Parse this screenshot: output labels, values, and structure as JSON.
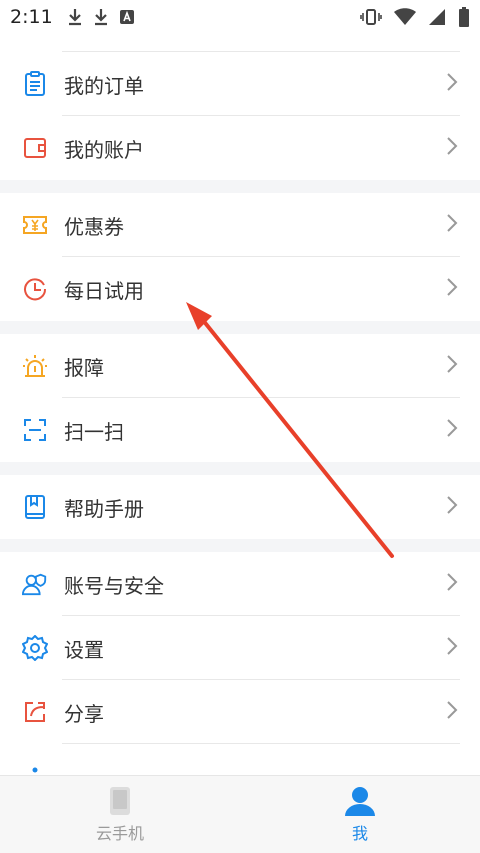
{
  "status_bar": {
    "time": "2:11"
  },
  "menu": {
    "group1": [
      {
        "label": "我的订单"
      },
      {
        "label": "我的账户"
      }
    ],
    "group2": [
      {
        "label": "优惠券"
      },
      {
        "label": "每日试用"
      }
    ],
    "group3": [
      {
        "label": "报障"
      },
      {
        "label": "扫一扫"
      }
    ],
    "group4": [
      {
        "label": "帮助手册"
      }
    ],
    "group5": [
      {
        "label": "账号与安全"
      },
      {
        "label": "设置"
      },
      {
        "label": "分享"
      }
    ]
  },
  "tabbar": {
    "tabs": [
      {
        "label": "云手机"
      },
      {
        "label": "我"
      }
    ]
  },
  "colors": {
    "accent_blue": "#1b88e8",
    "accent_red": "#e8533f",
    "accent_orange": "#f5a623",
    "annotation_arrow": "#e8402a"
  }
}
